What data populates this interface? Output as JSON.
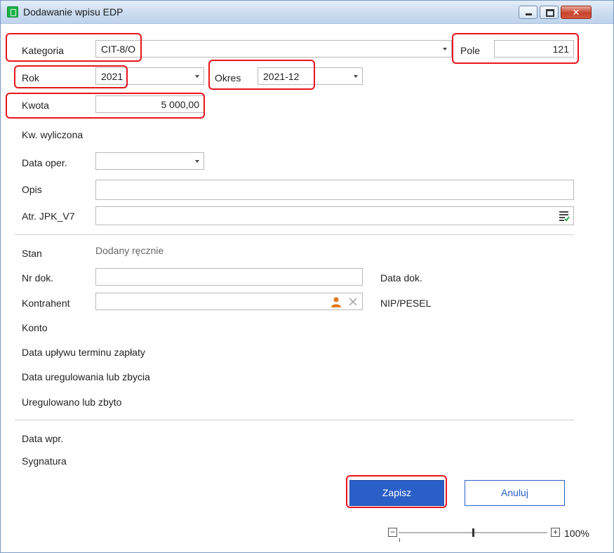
{
  "window": {
    "title": "Dodawanie wpisu EDP"
  },
  "form": {
    "kategoria": {
      "label": "Kategoria",
      "value": "CIT-8/O"
    },
    "pole": {
      "label": "Pole",
      "value": "121"
    },
    "rok": {
      "label": "Rok",
      "value": "2021"
    },
    "okres": {
      "label": "Okres",
      "value": "2021-12"
    },
    "kwota": {
      "label": "Kwota",
      "value": "5 000,00"
    },
    "kw_wyliczona": {
      "label": "Kw. wyliczona"
    },
    "data_oper": {
      "label": "Data oper.",
      "value": ""
    },
    "opis": {
      "label": "Opis",
      "value": ""
    },
    "atr_jpk": {
      "label": "Atr. JPK_V7",
      "value": ""
    },
    "stan": {
      "label": "Stan",
      "value": "Dodany ręcznie"
    },
    "nr_dok": {
      "label": "Nr dok.",
      "value": ""
    },
    "data_dok": {
      "label": "Data dok."
    },
    "kontrahent": {
      "label": "Kontrahent",
      "value": ""
    },
    "nip_pesel": {
      "label": "NIP/PESEL"
    },
    "konto": {
      "label": "Konto"
    },
    "data_uplywu": {
      "label": "Data upływu terminu zapłaty"
    },
    "data_uregulowania": {
      "label": "Data uregulowania lub zbycia"
    },
    "uregulowano": {
      "label": "Uregulowano lub zbyto"
    },
    "data_wpr": {
      "label": "Data wpr."
    },
    "sygnatura": {
      "label": "Sygnatura"
    }
  },
  "buttons": {
    "save": "Zapisz",
    "cancel": "Anuluj"
  },
  "zoom": {
    "minus": "−",
    "plus": "+",
    "percent": "100%",
    "level": 0.5
  },
  "colors": {
    "primary": "#2a5fc7",
    "highlight": "#e8141c",
    "contractor_icon": "#e07a1f"
  }
}
